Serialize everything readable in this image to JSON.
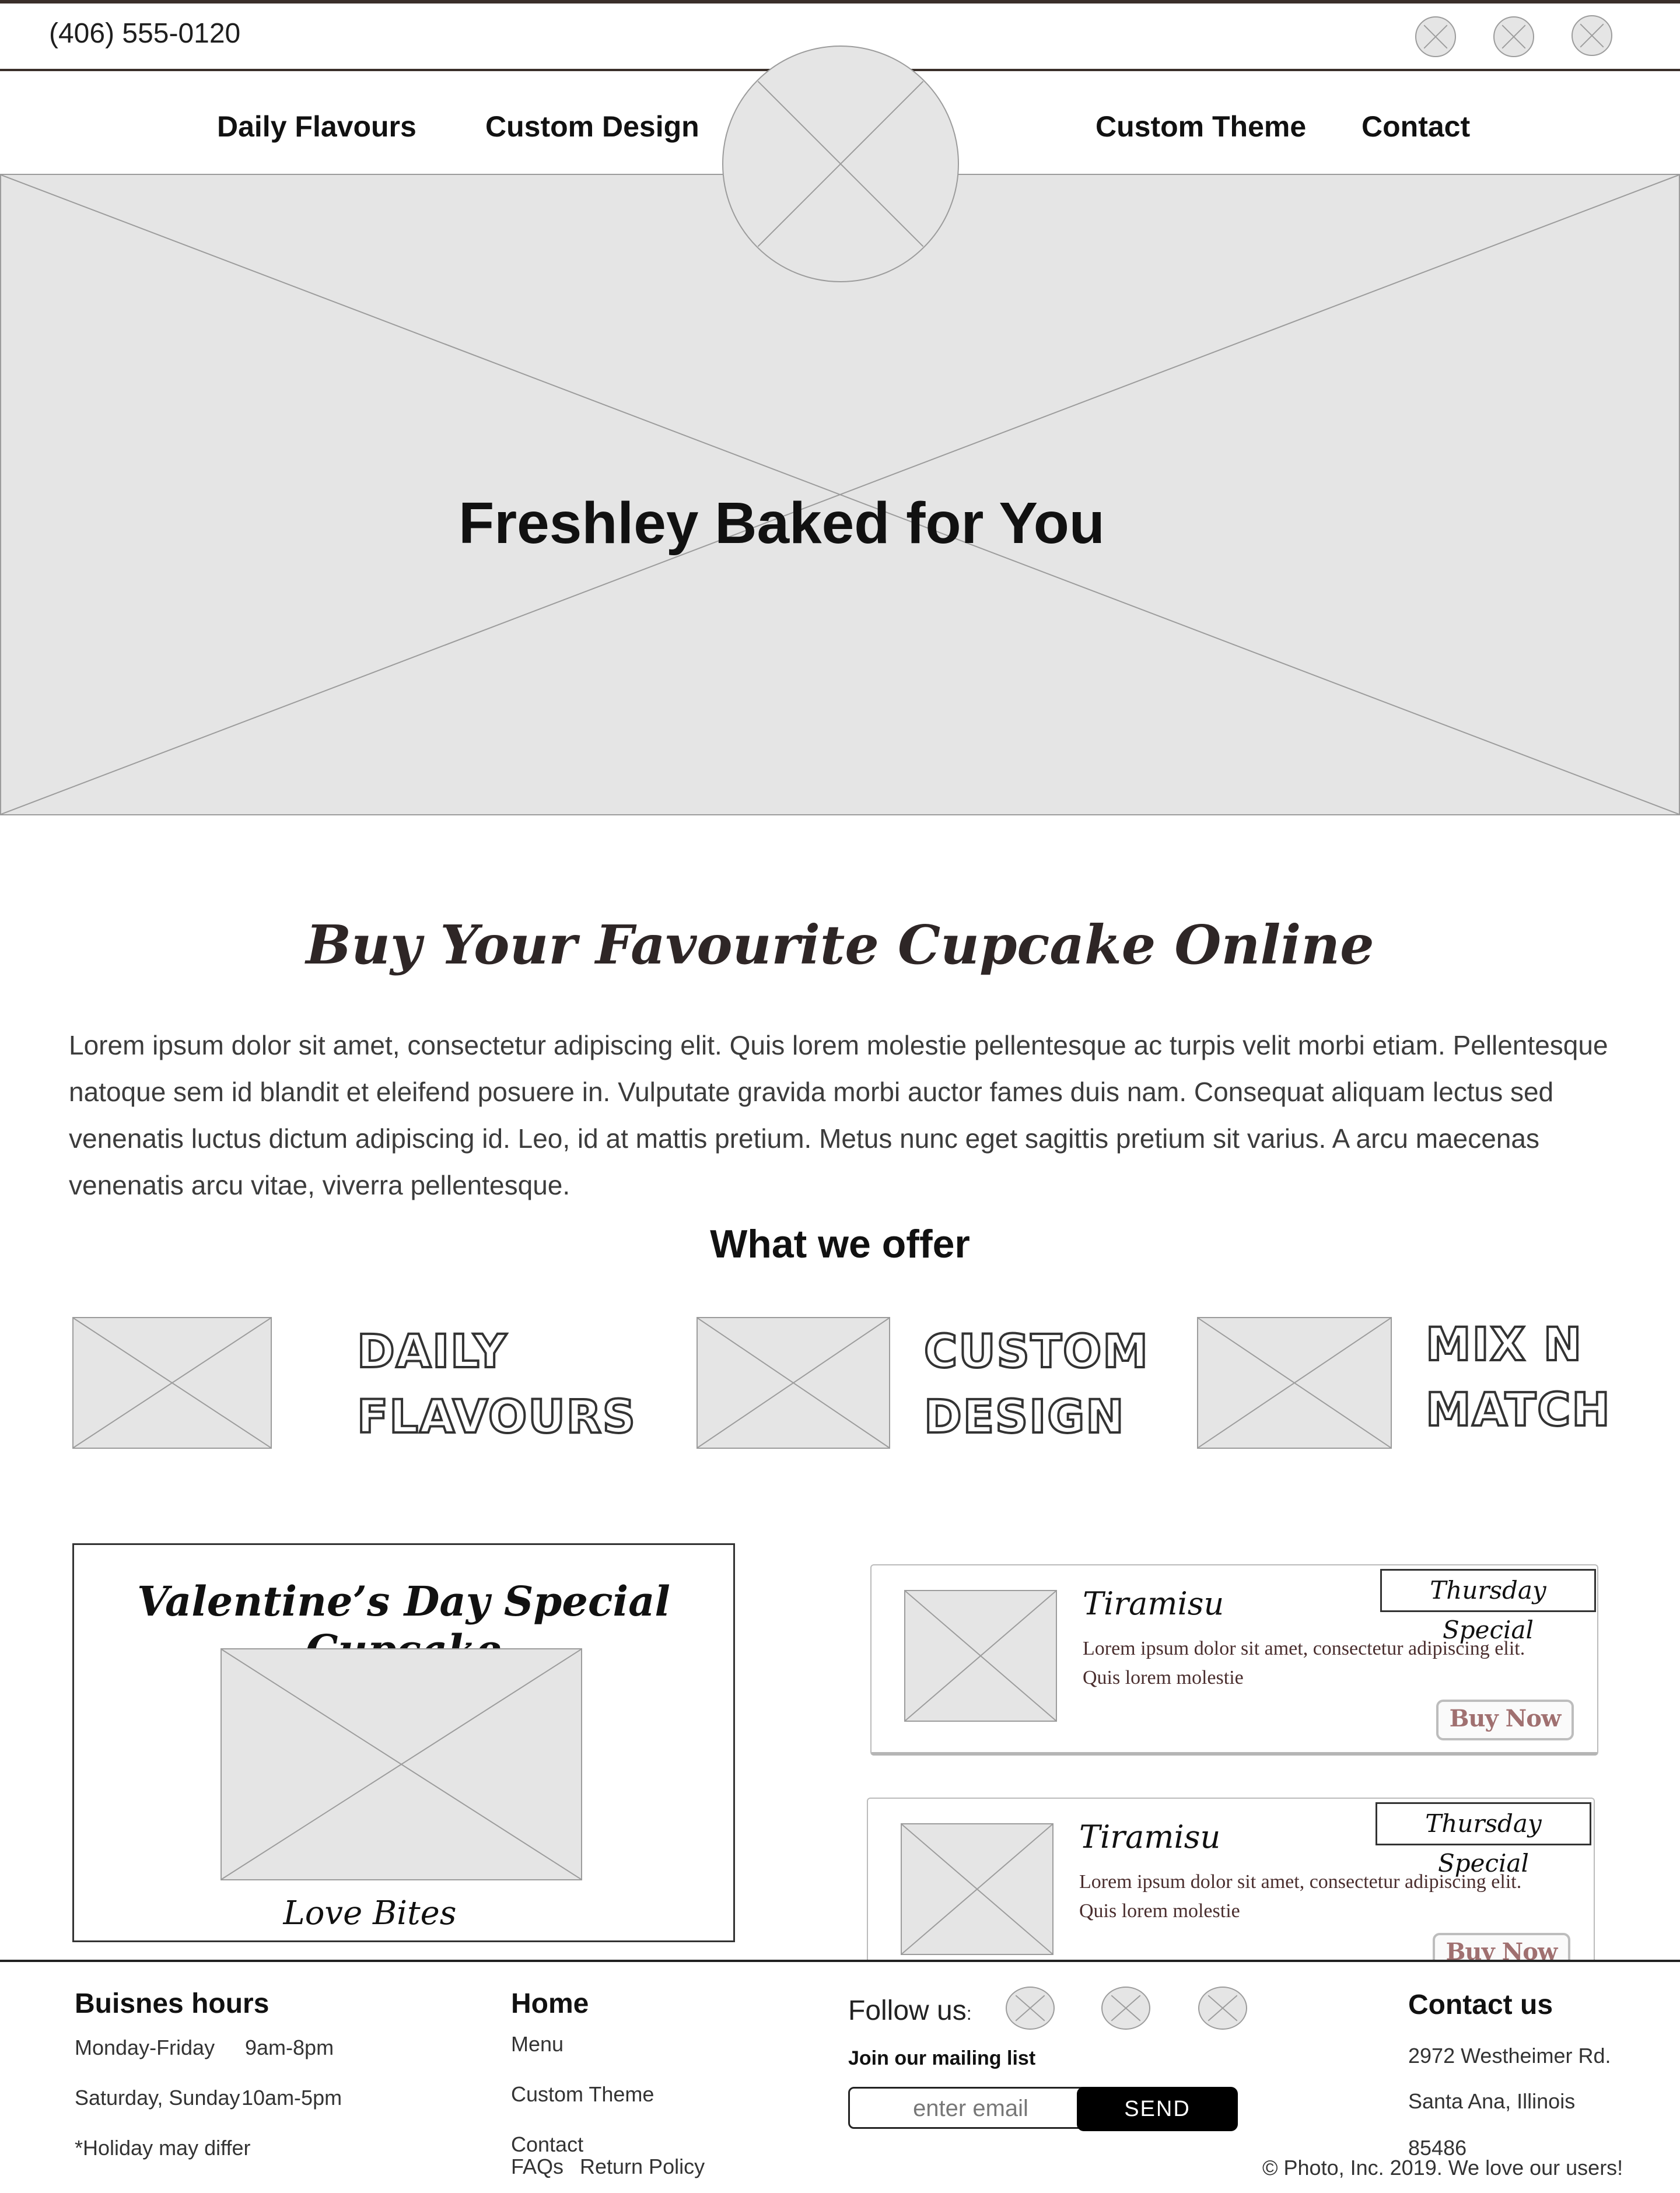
{
  "header": {
    "phone": "(406) 555-0120",
    "social_icons": [
      "social-icon-1",
      "social-icon-2",
      "social-icon-3"
    ]
  },
  "nav": {
    "items": [
      "Daily Flavours",
      "Custom Design",
      "Custom Theme",
      "Contact"
    ],
    "logo_icon": "logo-placeholder"
  },
  "hero": {
    "title": "Freshley Baked for You"
  },
  "intro": {
    "title": "Buy Your Favourite Cupcake Online",
    "body": "Lorem ipsum dolor sit amet, consectetur adipiscing elit. Quis lorem molestie pellentesque ac turpis velit morbi etiam. Pellentesque natoque sem id blandit et eleifend posuere in. Vulputate gravida morbi auctor fames duis nam. Consequat aliquam lectus sed venenatis luctus dictum adipiscing id. Leo, id at mattis pretium. Metus nunc eget sagittis pretium sit varius. A arcu maecenas venenatis arcu vitae, viverra pellentesque."
  },
  "offer": {
    "title": "What we offer",
    "items": [
      {
        "line1": "DAILY",
        "line2": "FLAVOURS"
      },
      {
        "line1": "CUSTOM",
        "line2": "DESIGN"
      },
      {
        "line1": "MIX N",
        "line2": "MATCH"
      }
    ]
  },
  "special": {
    "title": "Valentine’s Day Special Cupcake",
    "caption": "Love Bites"
  },
  "cards": [
    {
      "title": "Tiramisu",
      "badge": "Thursday Special",
      "desc_line1": "Lorem ipsum dolor sit amet, consectetur adipiscing elit.",
      "desc_line2": "Quis lorem molestie",
      "button": "Buy Now"
    },
    {
      "title": "Tiramisu",
      "badge": "Thursday Special",
      "desc_line1": "Lorem ipsum dolor sit amet, consectetur adipiscing elit.",
      "desc_line2": "Quis lorem molestie",
      "button": "Buy Now"
    }
  ],
  "footer": {
    "hours_title": "Buisnes hours",
    "hours": [
      {
        "days": "Monday-Friday",
        "time": "9am-8pm"
      },
      {
        "days": "Saturday, Sunday",
        "time": "10am-5pm"
      }
    ],
    "hours_note": "*Holiday may differ",
    "links_title": "Home",
    "links": [
      "Menu",
      "Custom Theme",
      "Contact"
    ],
    "bottom_links": [
      "FAQs",
      "Return Policy"
    ],
    "follow_title": "Follow us",
    "follow_colon": ":",
    "mailing_label": "Join our mailing list",
    "email_placeholder": "enter email",
    "send_label": "SEND",
    "contact_title": "Contact us",
    "address": [
      "2972 Westheimer Rd.",
      "Santa Ana, Illinois",
      "85486"
    ],
    "copyright": "© Photo, Inc. 2019. We love our users!"
  }
}
